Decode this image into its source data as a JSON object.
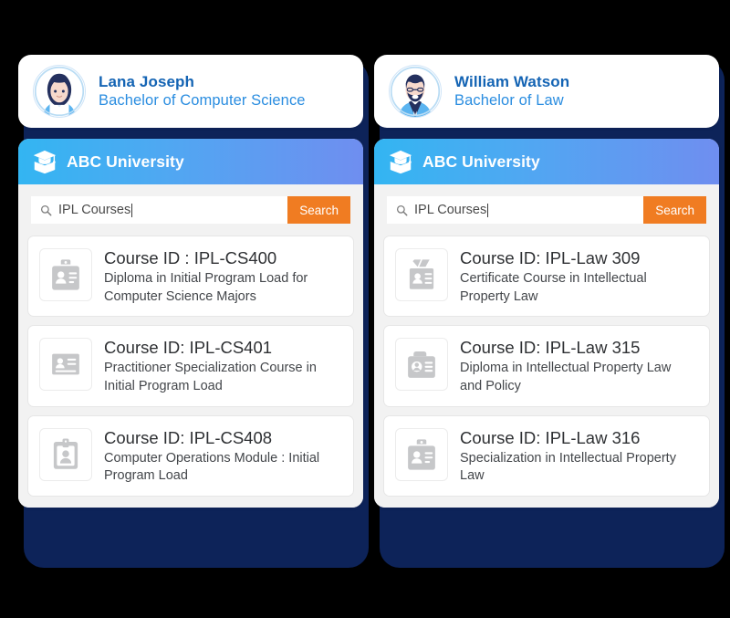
{
  "theme": {
    "background": "#000000",
    "plate_navy": "#0d2359",
    "header_gradient_start": "#33b5f2",
    "header_gradient_end": "#6f8ef0",
    "search_button": "#f07c22",
    "name_color": "#1464b4",
    "degree_color": "#2a8de0",
    "panel_bg": "#f2f2f2"
  },
  "columns": [
    {
      "profile": {
        "avatar_icon": "female-student-avatar",
        "name": "Lana Joseph",
        "degree": "Bachelor of Computer Science"
      },
      "panel": {
        "logo_icon": "graduation-cap-book-icon",
        "title": "ABC University",
        "search": {
          "icon": "search-icon",
          "value": "IPL Courses",
          "placeholder": "IPL Courses",
          "button_label": "Search"
        },
        "courses": [
          {
            "icon": "id-badge-icon",
            "id": "Course ID : IPL-CS400",
            "desc": "Diploma in Initial Program Load for Computer Science Majors"
          },
          {
            "icon": "id-card-lines-icon",
            "id": "Course ID: IPL-CS401",
            "desc": "Practitioner Specialization Course in Initial Program Load"
          },
          {
            "icon": "id-clipboard-icon",
            "id": "Course ID: IPL-CS408",
            "desc": "Computer Operations Module : Initial Program Load"
          }
        ]
      }
    },
    {
      "profile": {
        "avatar_icon": "male-bearded-avatar",
        "name": "William Watson",
        "degree": "Bachelor of Law"
      },
      "panel": {
        "logo_icon": "graduation-cap-book-icon",
        "title": "ABC University",
        "search": {
          "icon": "search-icon",
          "value": "IPL Courses",
          "placeholder": "IPL Courses",
          "button_label": "Search"
        },
        "courses": [
          {
            "icon": "id-card-ribbon-icon",
            "id": "Course ID: IPL-Law 309",
            "desc": "Certificate Course in Intellectual Property Law"
          },
          {
            "icon": "id-card-camera-icon",
            "id": "Course ID: IPL-Law 315",
            "desc": "Diploma in Intellectual Property Law and Policy"
          },
          {
            "icon": "id-badge-icon",
            "id": "Course ID: IPL-Law 316",
            "desc": "Specialization in Intellectual Property Law"
          }
        ]
      }
    }
  ]
}
